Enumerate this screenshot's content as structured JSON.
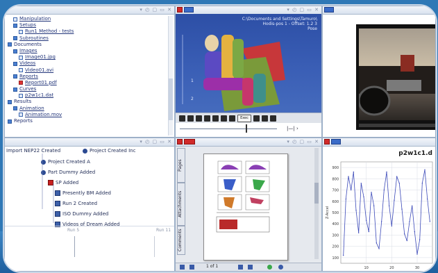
{
  "tree": {
    "items": [
      {
        "label": "Manipulation",
        "indent": 1,
        "icon": "doc",
        "underline": true
      },
      {
        "label": "Setups",
        "indent": 1,
        "icon": "folder",
        "underline": true
      },
      {
        "label": "Run1 Method - tests",
        "indent": 2,
        "icon": "doc",
        "underline": true
      },
      {
        "label": "Subroutines",
        "indent": 1,
        "icon": "folder",
        "underline": true
      },
      {
        "label": "Documents",
        "indent": 0,
        "icon": "folder",
        "underline": false
      },
      {
        "label": "Images",
        "indent": 1,
        "icon": "folder",
        "underline": true
      },
      {
        "label": "Image01.jpg",
        "indent": 2,
        "icon": "doc",
        "underline": true
      },
      {
        "label": "Videos",
        "indent": 1,
        "icon": "folder",
        "underline": true
      },
      {
        "label": "Video01.avi",
        "indent": 2,
        "icon": "doc",
        "underline": true
      },
      {
        "label": "Reports",
        "indent": 1,
        "icon": "folder",
        "underline": true
      },
      {
        "label": "Report01.pdf",
        "indent": 2,
        "icon": "pdf",
        "underline": true
      },
      {
        "label": "Curves",
        "indent": 1,
        "icon": "folder",
        "underline": true
      },
      {
        "label": "p2w1c1.dat",
        "indent": 2,
        "icon": "doc",
        "underline": true
      },
      {
        "label": "Results",
        "indent": 0,
        "icon": "folder",
        "underline": false
      },
      {
        "label": "Animation",
        "indent": 1,
        "icon": "folder",
        "underline": true
      },
      {
        "label": "Animation.mov",
        "indent": 2,
        "icon": "doc",
        "underline": true
      },
      {
        "label": "Reports",
        "indent": 0,
        "icon": "folder",
        "underline": false
      }
    ]
  },
  "panes": {
    "control_glyphs": "▾ ◴ ▢ ▭ ✕",
    "control_glyphs_short": "▾ ◴ ▢ ✕"
  },
  "viewer3d": {
    "info_line1": "C:\\Documents and Settings\\Tamuro\\",
    "info_line2": "Hodis-pos 1 - Offset: 1.2 3",
    "info_line3": "Pose",
    "button_label": "Exec",
    "axis_labels": [
      "1",
      "2"
    ]
  },
  "flow": {
    "header_left": "Import NEP22 Created",
    "header_right": "Project Created Inc",
    "items": [
      {
        "label": "Project Created A",
        "kind": "dot",
        "level": 0
      },
      {
        "label": "Part Dummy Added",
        "kind": "dot",
        "level": 0
      },
      {
        "label": "SP Added",
        "kind": "red",
        "level": 1
      },
      {
        "label": "Presently BM Added",
        "kind": "box",
        "level": 2
      },
      {
        "label": "Run 2 Created",
        "kind": "box",
        "level": 2
      },
      {
        "label": "ISO Dummy Added",
        "kind": "box",
        "level": 2
      },
      {
        "label": "Videos of Dream Added",
        "kind": "box",
        "level": 2
      }
    ],
    "footer_left": "Run 5",
    "footer_right": "Run 11"
  },
  "document": {
    "tabs": [
      "Pages",
      "Attachments",
      "Comments"
    ],
    "page_indicator": "1 of 1"
  },
  "chart_data": {
    "type": "line",
    "title": "p2w1c1.d",
    "xlabel": "",
    "ylabel": "Z-Accel",
    "y_ticks": [
      "900",
      "800",
      "700",
      "600",
      "500",
      "400",
      "300",
      "200",
      "100"
    ],
    "x_ticks": [
      "10",
      "20",
      "30"
    ],
    "xlim": [
      0,
      36
    ],
    "ylim": [
      50,
      950
    ],
    "grid": true,
    "series": [
      {
        "values": [
          [
            1,
            120
          ],
          [
            2,
            620
          ],
          [
            3,
            820
          ],
          [
            4,
            700
          ],
          [
            5,
            860
          ],
          [
            6,
            520
          ],
          [
            7,
            320
          ],
          [
            8,
            760
          ],
          [
            9,
            640
          ],
          [
            10,
            430
          ],
          [
            11,
            330
          ],
          [
            12,
            680
          ],
          [
            13,
            560
          ],
          [
            14,
            230
          ],
          [
            15,
            180
          ],
          [
            16,
            420
          ],
          [
            17,
            700
          ],
          [
            18,
            860
          ],
          [
            19,
            560
          ],
          [
            20,
            380
          ],
          [
            21,
            610
          ],
          [
            22,
            820
          ],
          [
            23,
            760
          ],
          [
            24,
            530
          ],
          [
            25,
            310
          ],
          [
            26,
            250
          ],
          [
            27,
            420
          ],
          [
            28,
            560
          ],
          [
            29,
            330
          ],
          [
            30,
            130
          ],
          [
            31,
            260
          ],
          [
            32,
            760
          ],
          [
            33,
            880
          ],
          [
            34,
            620
          ],
          [
            35,
            420
          ]
        ]
      }
    ]
  },
  "colors": {
    "accent": "#2f78b6",
    "series": "#3a48b8",
    "title_bar": "#d8e1ee"
  }
}
